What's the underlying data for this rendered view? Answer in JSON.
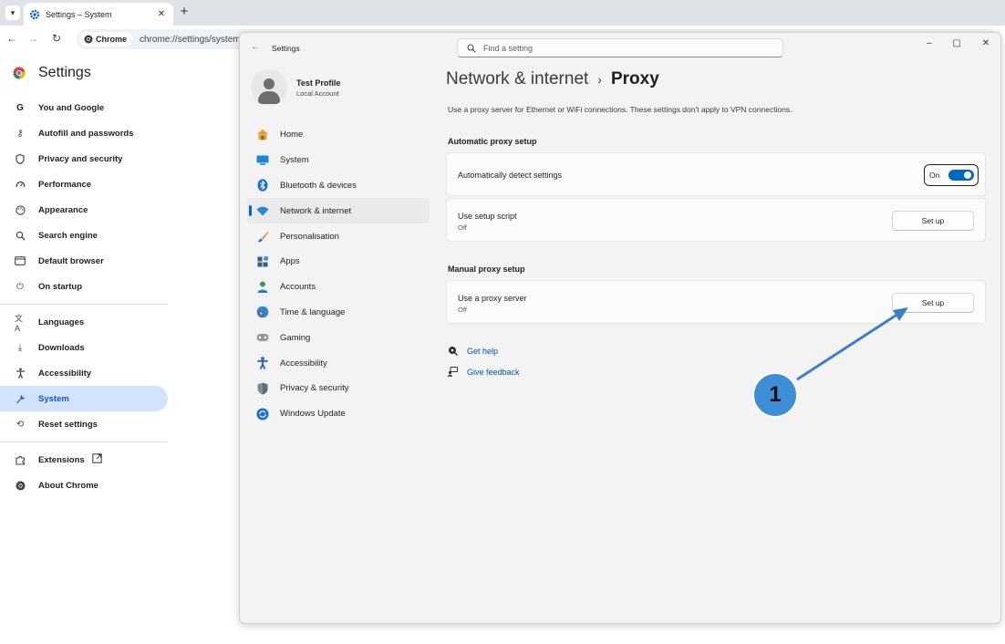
{
  "browser": {
    "tab_title": "Settings – System",
    "url_chip": "Chrome",
    "url": "chrome://settings/system"
  },
  "chrome_settings": {
    "title": "Settings",
    "nav": [
      {
        "label": "You and Google",
        "icon": "google-icon"
      },
      {
        "label": "Autofill and passwords",
        "icon": "key-icon"
      },
      {
        "label": "Privacy and security",
        "icon": "shield-icon"
      },
      {
        "label": "Performance",
        "icon": "speedometer-icon"
      },
      {
        "label": "Appearance",
        "icon": "palette-icon"
      },
      {
        "label": "Search engine",
        "icon": "search-icon"
      },
      {
        "label": "Default browser",
        "icon": "browser-icon"
      },
      {
        "label": "On startup",
        "icon": "power-icon"
      },
      {
        "label": "Languages",
        "icon": "translate-icon"
      },
      {
        "label": "Downloads",
        "icon": "download-icon"
      },
      {
        "label": "Accessibility",
        "icon": "accessibility-icon"
      },
      {
        "label": "System",
        "icon": "wrench-icon"
      },
      {
        "label": "Reset settings",
        "icon": "reset-icon"
      },
      {
        "label": "Extensions",
        "icon": "puzzle-icon"
      },
      {
        "label": "About Chrome",
        "icon": "chrome-icon"
      }
    ]
  },
  "win_settings": {
    "title": "Settings",
    "search_placeholder": "Find a setting",
    "profile": {
      "name": "Test Profile",
      "type": "Local Account"
    },
    "nav": [
      {
        "label": "Home",
        "icon": "home-icon"
      },
      {
        "label": "System",
        "icon": "monitor-icon"
      },
      {
        "label": "Bluetooth & devices",
        "icon": "bluetooth-icon"
      },
      {
        "label": "Network & internet",
        "icon": "wifi-icon"
      },
      {
        "label": "Personalisation",
        "icon": "brush-icon"
      },
      {
        "label": "Apps",
        "icon": "apps-icon"
      },
      {
        "label": "Accounts",
        "icon": "person-icon"
      },
      {
        "label": "Time & language",
        "icon": "globe-clock-icon"
      },
      {
        "label": "Gaming",
        "icon": "gamepad-icon"
      },
      {
        "label": "Accessibility",
        "icon": "accessibility-icon"
      },
      {
        "label": "Privacy & security",
        "icon": "shield-icon"
      },
      {
        "label": "Windows Update",
        "icon": "update-icon"
      }
    ],
    "breadcrumb": {
      "parent": "Network & internet",
      "separator": "›",
      "current": "Proxy"
    },
    "description": "Use a proxy server for Ethernet or WiFi connections. These settings don't apply to VPN connections.",
    "auto_section": {
      "title": "Automatic proxy setup",
      "detect_label": "Automatically detect settings",
      "detect_state": "On",
      "script_label": "Use setup script",
      "script_state": "Off",
      "script_button": "Set up"
    },
    "manual_section": {
      "title": "Manual proxy setup",
      "proxy_label": "Use a proxy server",
      "proxy_state": "Off",
      "proxy_button": "Set up"
    },
    "help": {
      "get_help": "Get help",
      "give_feedback": "Give feedback"
    }
  },
  "annotation": {
    "number": "1",
    "color": "#3d8ed6"
  }
}
